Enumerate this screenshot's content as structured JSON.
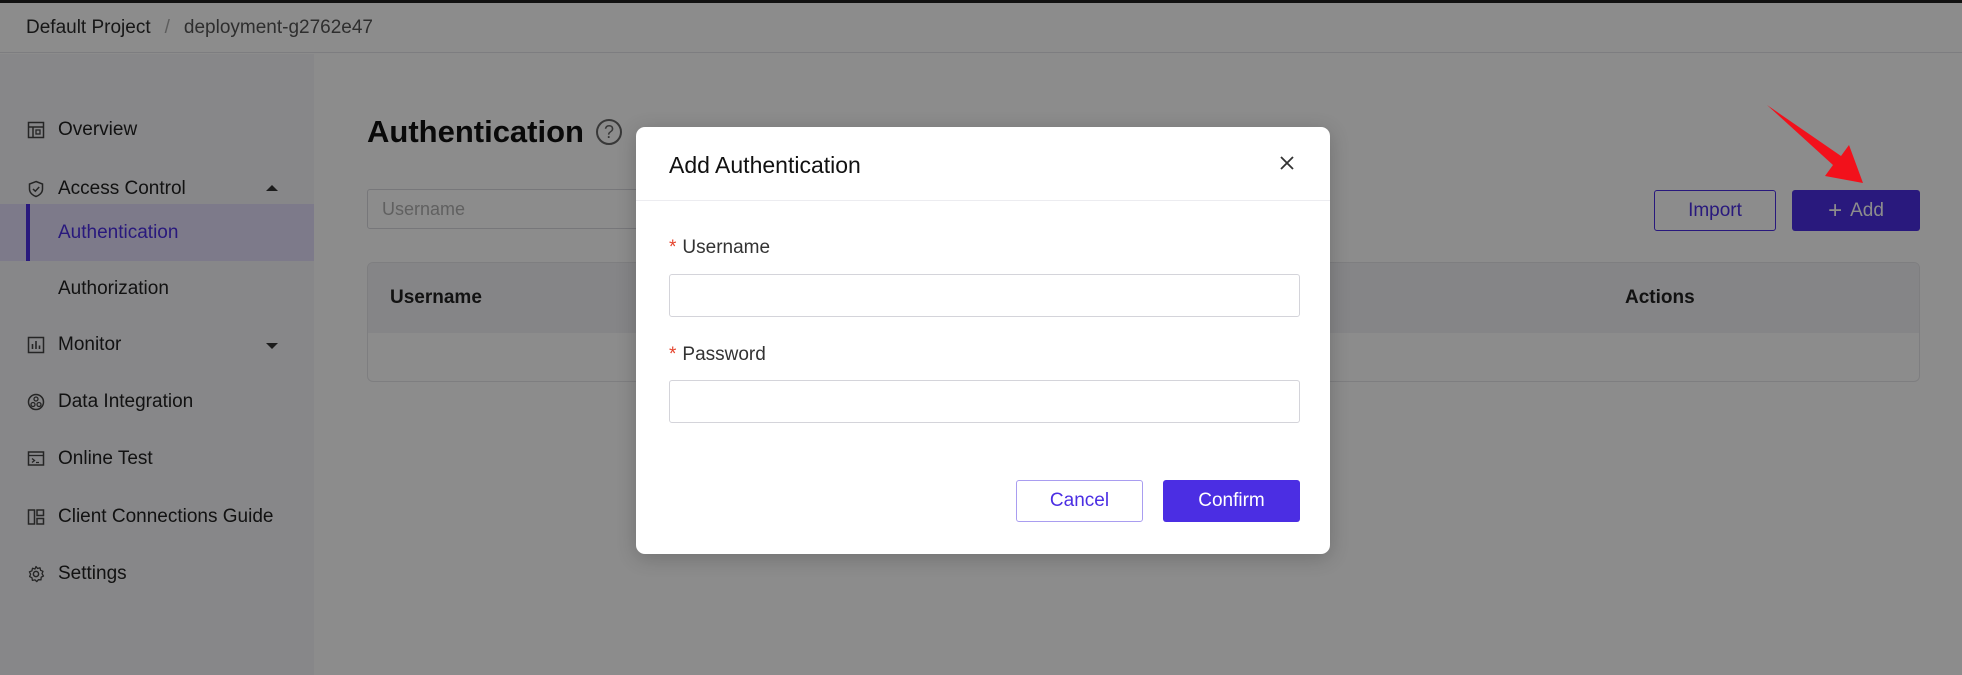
{
  "breadcrumb": {
    "project": "Default Project",
    "separator": "/",
    "deployment": "deployment-g2762e47"
  },
  "sidebar": {
    "items": [
      {
        "label": "Overview",
        "icon": "dashboard-icon"
      },
      {
        "label": "Access Control",
        "icon": "shield-icon",
        "expanded": true
      },
      {
        "label": "Authentication",
        "active": true
      },
      {
        "label": "Authorization"
      },
      {
        "label": "Monitor",
        "icon": "chart-icon",
        "expanded": false
      },
      {
        "label": "Data Integration",
        "icon": "integration-icon"
      },
      {
        "label": "Online Test",
        "icon": "terminal-icon"
      },
      {
        "label": "Client Connections Guide",
        "icon": "guide-icon"
      },
      {
        "label": "Settings",
        "icon": "gear-icon"
      }
    ]
  },
  "main": {
    "title": "Authentication",
    "search_placeholder": "Username",
    "import_label": "Import",
    "add_label": "Add",
    "table": {
      "columns": [
        "Username",
        "Actions"
      ]
    }
  },
  "modal": {
    "title": "Add Authentication",
    "required_mark": "*",
    "username_label": "Username",
    "password_label": "Password",
    "cancel_label": "Cancel",
    "confirm_label": "Confirm"
  },
  "colors": {
    "accent": "#4b2ee3",
    "required": "#e5432d",
    "annotation_arrow": "#f2111b"
  }
}
